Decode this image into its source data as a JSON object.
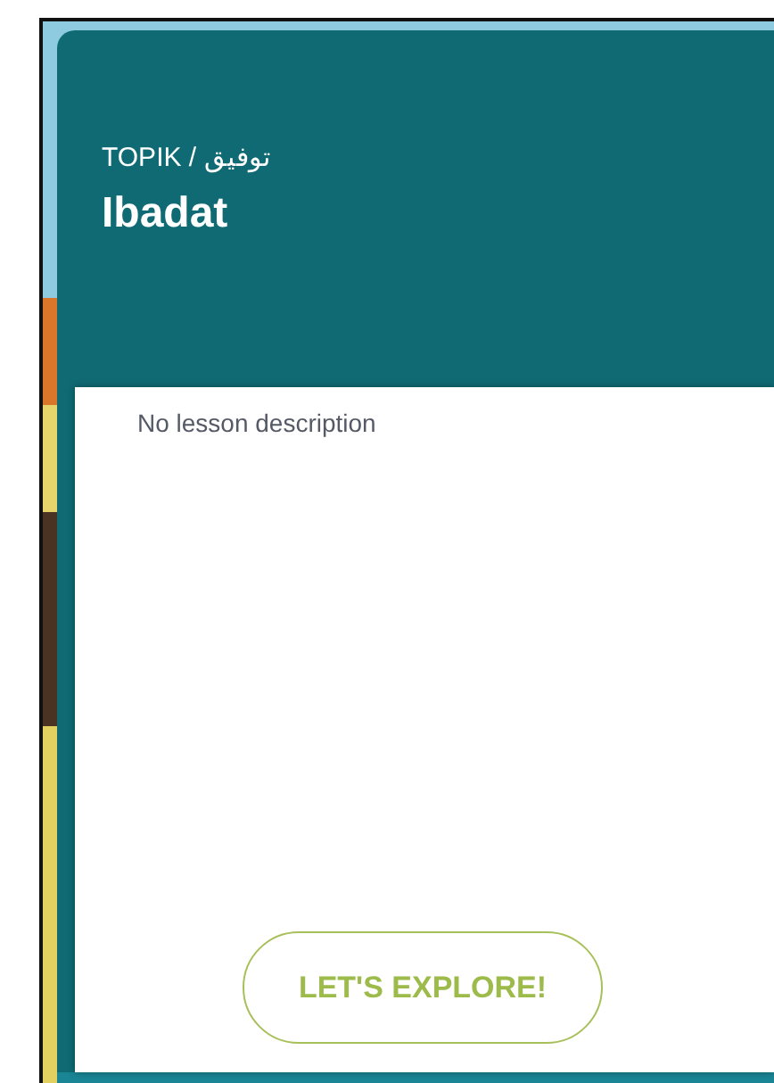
{
  "lesson": {
    "breadcrumb": "TOPIK / توفيق",
    "title": "Ibadat",
    "description": "No lesson description"
  },
  "button": {
    "label": "LET'S EXPLORE!"
  }
}
